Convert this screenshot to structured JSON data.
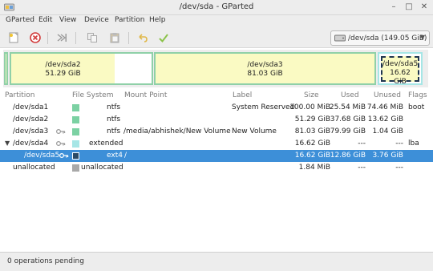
{
  "window": {
    "title": "/dev/sda - GParted"
  },
  "menu": [
    "GParted",
    "Edit",
    "View",
    "Device",
    "Partition",
    "Help"
  ],
  "toolbar": {
    "buttons": [
      "new-partition-icon",
      "delete-icon",
      "resize-move-icon",
      "copy-icon",
      "paste-icon",
      "undo-icon",
      "apply-icon"
    ],
    "device_label": "/dev/sda (149.05 GiB)"
  },
  "disk_map": [
    {
      "name": "/dev/sda2",
      "size": "51.29 GiB"
    },
    {
      "name": "/dev/sda3",
      "size": "81.03 GiB"
    },
    {
      "name": "/dev/sda5",
      "size": "16.62 GiB"
    }
  ],
  "table": {
    "headers": {
      "partition": "Partition",
      "filesystem": "File System",
      "mount": "Mount Point",
      "label": "Label",
      "size": "Size",
      "used": "Used",
      "unused": "Unused",
      "flags": "Flags"
    },
    "rows": [
      {
        "partition": "/dev/sda1",
        "filesystem": "ntfs",
        "mount": "",
        "label": "System Reserved",
        "size": "100.00 MiB",
        "used": "25.54 MiB",
        "unused": "74.46 MiB",
        "flags": "boot",
        "color": "#7cd1a3"
      },
      {
        "partition": "/dev/sda2",
        "filesystem": "ntfs",
        "mount": "",
        "label": "",
        "size": "51.29 GiB",
        "used": "37.68 GiB",
        "unused": "13.62 GiB",
        "flags": "",
        "color": "#7cd1a3"
      },
      {
        "partition": "/dev/sda3",
        "filesystem": "ntfs",
        "mount": "/media/abhishek/New Volume",
        "label": "New Volume",
        "size": "81.03 GiB",
        "used": "79.99 GiB",
        "unused": "1.04 GiB",
        "flags": "",
        "color": "#7cd1a3"
      },
      {
        "partition": "/dev/sda4",
        "filesystem": "extended",
        "mount": "",
        "label": "",
        "size": "16.62 GiB",
        "used": "---",
        "unused": "---",
        "flags": "lba",
        "color": "#a6e6e6"
      },
      {
        "partition": "/dev/sda5",
        "filesystem": "ext4",
        "mount": "/",
        "label": "",
        "size": "16.62 GiB",
        "used": "12.86 GiB",
        "unused": "3.76 GiB",
        "flags": "",
        "color": "#2b4a66"
      },
      {
        "partition": "unallocated",
        "filesystem": "unallocated",
        "mount": "",
        "label": "",
        "size": "1.84 MiB",
        "used": "---",
        "unused": "---",
        "flags": "",
        "color": "#a9a9a9"
      }
    ]
  },
  "status": {
    "text": "0 operations pending"
  },
  "colors": {
    "selection": "#3d8fd8",
    "ntfs": "#7cd1a3",
    "extended": "#a6e6e6",
    "ext4": "#2b4a66",
    "unallocated": "#a9a9a9"
  }
}
